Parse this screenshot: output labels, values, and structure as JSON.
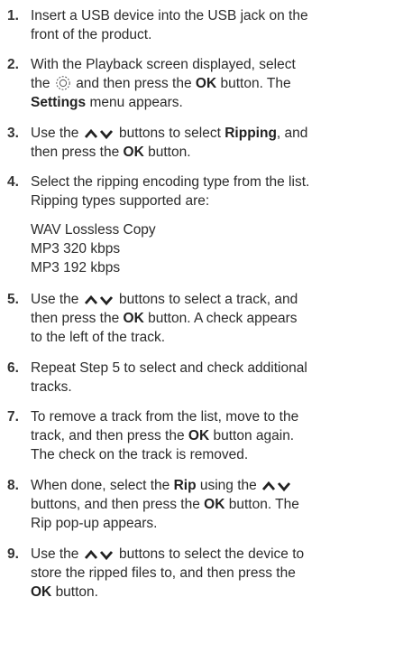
{
  "steps": [
    {
      "num": "1.",
      "l1": "Insert a USB device into the USB jack on the",
      "l2": "front of the product."
    },
    {
      "num": "2.",
      "l1": "With the Playback screen displayed, select",
      "l2a": "the",
      "l2b": "and then press the",
      "ok": "OK",
      "l2c": "button. The",
      "settings": "Settings",
      "l3": "menu appears."
    },
    {
      "num": "3.",
      "l1a": "Use the",
      "l1b": "buttons to select",
      "ripping": "Ripping",
      "l1c": ", and",
      "l2a": "then press the",
      "ok": "OK",
      "l2b": "button."
    },
    {
      "num": "4.",
      "l1": "Select the ripping encoding type from the list.",
      "l2": "Ripping types supported are:",
      "types": [
        "WAV Lossless Copy",
        "MP3 320 kbps",
        "MP3 192 kbps"
      ]
    },
    {
      "num": "5.",
      "l1a": "Use the",
      "l1b": "buttons to select a track, and",
      "l2a": "then press the",
      "ok": "OK",
      "l2b": "button. A check appears",
      "l3": "to the left of the track."
    },
    {
      "num": "6.",
      "l1": "Repeat Step 5 to select and check additional",
      "l2": "tracks."
    },
    {
      "num": "7.",
      "l1": "To remove a track from the list, move to the",
      "l2a": "track, and then press the",
      "ok": "OK",
      "l2b": "button again.",
      "l3": "The check on the track is removed."
    },
    {
      "num": "8.",
      "l1a": "When done, select the",
      "rip": "Rip",
      "l1b": "using the",
      "l2a": "buttons, and then press the",
      "ok": "OK",
      "l2b": "button. The",
      "l3": "Rip pop-up appears."
    },
    {
      "num": "9.",
      "l1a": "Use the",
      "l1b": "buttons to select the device to",
      "l2": "store the ripped files to, and then press the",
      "ok": "OK",
      "l3b": "button."
    }
  ],
  "icons": {
    "settings": "gear-icon",
    "updown": "up-down-arrows-icon"
  }
}
